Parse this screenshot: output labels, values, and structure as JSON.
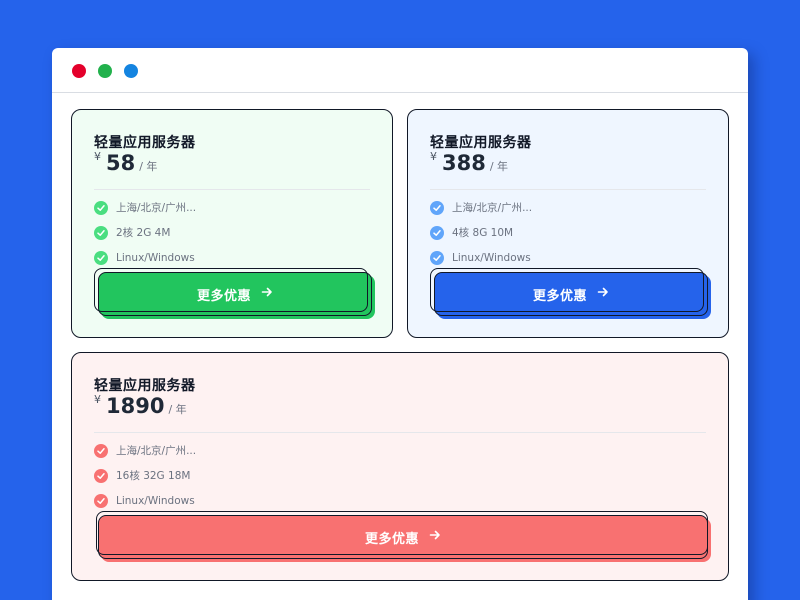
{
  "cards": [
    {
      "title": "轻量应用服务器",
      "currency": "¥",
      "price": "58",
      "period": "/ 年",
      "features": [
        "上海/北京/广州...",
        "2核 2G 4M",
        "Linux/Windows"
      ],
      "cta_label": "更多优惠",
      "accent": "#22c55e"
    },
    {
      "title": "轻量应用服务器",
      "currency": "¥",
      "price": "388",
      "period": "/ 年",
      "features": [
        "上海/北京/广州...",
        "4核 8G 10M",
        "Linux/Windows"
      ],
      "cta_label": "更多优惠",
      "accent": "#2563eb"
    },
    {
      "title": "轻量应用服务器",
      "currency": "¥",
      "price": "1890",
      "period": "/ 年",
      "features": [
        "上海/北京/广州...",
        "16核 32G 18M",
        "Linux/Windows"
      ],
      "cta_label": "更多优惠",
      "accent": "#f87171"
    }
  ],
  "icons": {
    "feature": "check-circle-icon",
    "cta": "arrow-right-icon",
    "window_controls": [
      "close-dot-icon",
      "minimize-dot-icon",
      "maximize-dot-icon"
    ]
  }
}
